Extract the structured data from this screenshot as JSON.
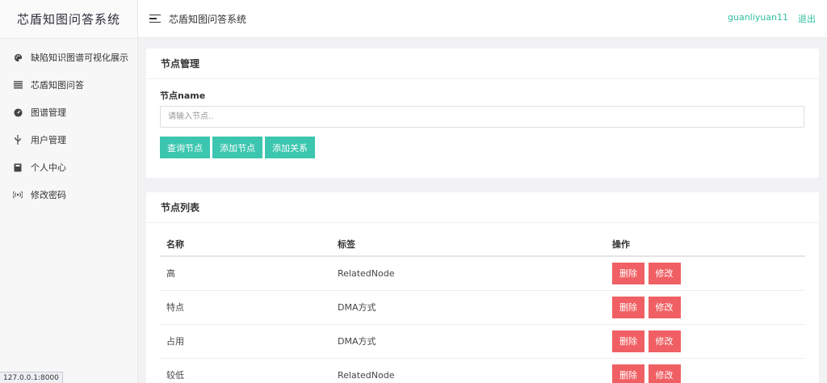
{
  "brand": "芯盾知图问答系统",
  "sidebar": {
    "items": [
      {
        "label": "缺陷知识图谱可视化展示",
        "icon": "palette-icon"
      },
      {
        "label": "芯盾知图问答",
        "icon": "list-icon"
      },
      {
        "label": "图谱管理",
        "icon": "dashboard-icon"
      },
      {
        "label": "用户管理",
        "icon": "usb-icon"
      },
      {
        "label": "个人中心",
        "icon": "book-icon"
      },
      {
        "label": "修改密码",
        "icon": "broadcast-icon"
      }
    ]
  },
  "header": {
    "title": "芯盾知图问答系统",
    "username": "guanliyuan11",
    "logout": "退出"
  },
  "node_mgmt": {
    "title": "节点管理",
    "field_label": "节点name",
    "placeholder": "请输入节点..",
    "value": "",
    "buttons": {
      "query": "查询节点",
      "add_node": "添加节点",
      "add_relation": "添加关系"
    }
  },
  "node_list": {
    "title": "节点列表",
    "columns": [
      "名称",
      "标签",
      "操作"
    ],
    "rows": [
      {
        "name": "高",
        "label": "RelatedNode"
      },
      {
        "name": "特点",
        "label": "DMA方式"
      },
      {
        "name": "占用",
        "label": "DMA方式"
      },
      {
        "name": "较低",
        "label": "RelatedNode"
      }
    ],
    "delete_label": "删除",
    "edit_label": "修改"
  },
  "status_url": "127.0.0.1:8000",
  "colors": {
    "accent": "#3cc6b0",
    "danger": "#f05f63",
    "link": "#30bfa3"
  }
}
